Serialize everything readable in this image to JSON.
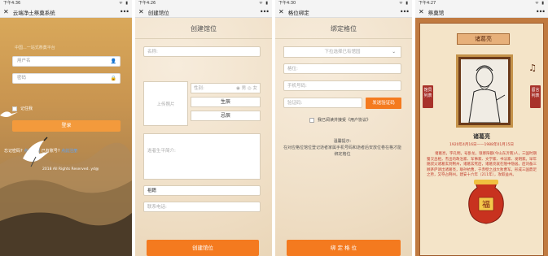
{
  "screens": [
    {
      "status": {
        "time": "下午4:36",
        "icons": "ᯤ ▮"
      },
      "nav": {
        "title": "云端净土祭奠系统",
        "close": "✕",
        "more": "•••"
      },
      "login": {
        "subtitle": "中国...一站式祭奠平台",
        "username_placeholder": "用户名",
        "password_placeholder": "密码",
        "remember": "记住我",
        "submit": "登录",
        "forgot": "忘记密码?",
        "find_back": "点此找回",
        "have_account": "已有账号?",
        "register": "点此注册",
        "copyright": "2018 All Rights Reserved. yd@"
      }
    },
    {
      "status": {
        "time": "下午4:26",
        "icons": "ᯤ ▮"
      },
      "nav": {
        "title": "创建馆位",
        "close": "✕",
        "more": "•••"
      },
      "form": {
        "heading": "创建馆位",
        "name_placeholder": "名称:",
        "upload": "上传照片",
        "gender_label": "性别:",
        "gender_male": "◉ 男",
        "gender_female": "◎ 女",
        "birth": "生辰",
        "death": "忌辰",
        "bio_placeholder": "逝者生平简介:",
        "relation": "祖籍",
        "phone_placeholder": "联系电话:",
        "submit": "创建馆位"
      }
    },
    {
      "status": {
        "time": "下午4:30",
        "icons": "ᯤ ▮"
      },
      "nav": {
        "title": "格位绑定",
        "close": "✕",
        "more": "•••"
      },
      "bind": {
        "heading": "绑定格位",
        "select_placeholder": "下拉选择已有馆园",
        "seat_placeholder": "格位:",
        "phone_placeholder": "手机号码:",
        "code_placeholder": "验证码:",
        "send_code": "发送验证码",
        "agree_text": "我已阅读并接受《用户协议》",
        "tip_title": "温馨提示:",
        "tip_body": "在对应格位馆位登记逝者家属手机号码和逝者后安放位卷在格才能绑定格位",
        "submit": "绑 定 格 位"
      }
    },
    {
      "status": {
        "time": "下午4:27",
        "icons": "ᯤ ▮"
      },
      "nav": {
        "title": "祭奠馆",
        "close": "✕",
        "more": "•••"
      },
      "memorial": {
        "plate": "诸葛亮",
        "left_tag": "馆员列表",
        "right_tag": "留言列表",
        "music_icon": "♫",
        "name": "诸葛亮",
        "dates": "1920年4月16日——1988年01月15日",
        "bio": "诸葛亮，字孔明，号卧龙，琅琊阳都(今山东沂南)人，三国时期蜀汉丞相，杰出的政治家、军事家、文学家、书法家、发明家。早年随叔父诸葛玄到荆州，诸葛玄死后，诸葛亮就在隆中隐居。后刘备三顾茅庐请出诸葛亮，联孙抗曹，于赤壁之战大败曹军。形成三国鼎足之势，又夺占荆州。建安十六年（211年），攻取益州。",
        "urn_label": "福"
      }
    }
  ]
}
